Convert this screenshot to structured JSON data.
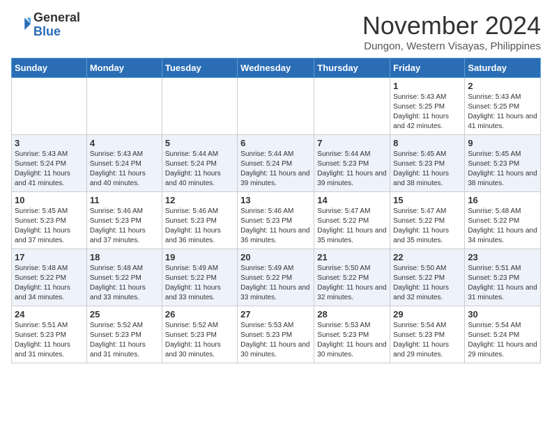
{
  "logo": {
    "general": "General",
    "blue": "Blue"
  },
  "header": {
    "month_title": "November 2024",
    "subtitle": "Dungon, Western Visayas, Philippines"
  },
  "weekdays": [
    "Sunday",
    "Monday",
    "Tuesday",
    "Wednesday",
    "Thursday",
    "Friday",
    "Saturday"
  ],
  "weeks": [
    [
      {
        "day": "",
        "info": ""
      },
      {
        "day": "",
        "info": ""
      },
      {
        "day": "",
        "info": ""
      },
      {
        "day": "",
        "info": ""
      },
      {
        "day": "",
        "info": ""
      },
      {
        "day": "1",
        "info": "Sunrise: 5:43 AM\nSunset: 5:25 PM\nDaylight: 11 hours and 42 minutes."
      },
      {
        "day": "2",
        "info": "Sunrise: 5:43 AM\nSunset: 5:25 PM\nDaylight: 11 hours and 41 minutes."
      }
    ],
    [
      {
        "day": "3",
        "info": "Sunrise: 5:43 AM\nSunset: 5:24 PM\nDaylight: 11 hours and 41 minutes."
      },
      {
        "day": "4",
        "info": "Sunrise: 5:43 AM\nSunset: 5:24 PM\nDaylight: 11 hours and 40 minutes."
      },
      {
        "day": "5",
        "info": "Sunrise: 5:44 AM\nSunset: 5:24 PM\nDaylight: 11 hours and 40 minutes."
      },
      {
        "day": "6",
        "info": "Sunrise: 5:44 AM\nSunset: 5:24 PM\nDaylight: 11 hours and 39 minutes."
      },
      {
        "day": "7",
        "info": "Sunrise: 5:44 AM\nSunset: 5:23 PM\nDaylight: 11 hours and 39 minutes."
      },
      {
        "day": "8",
        "info": "Sunrise: 5:45 AM\nSunset: 5:23 PM\nDaylight: 11 hours and 38 minutes."
      },
      {
        "day": "9",
        "info": "Sunrise: 5:45 AM\nSunset: 5:23 PM\nDaylight: 11 hours and 38 minutes."
      }
    ],
    [
      {
        "day": "10",
        "info": "Sunrise: 5:45 AM\nSunset: 5:23 PM\nDaylight: 11 hours and 37 minutes."
      },
      {
        "day": "11",
        "info": "Sunrise: 5:46 AM\nSunset: 5:23 PM\nDaylight: 11 hours and 37 minutes."
      },
      {
        "day": "12",
        "info": "Sunrise: 5:46 AM\nSunset: 5:23 PM\nDaylight: 11 hours and 36 minutes."
      },
      {
        "day": "13",
        "info": "Sunrise: 5:46 AM\nSunset: 5:23 PM\nDaylight: 11 hours and 36 minutes."
      },
      {
        "day": "14",
        "info": "Sunrise: 5:47 AM\nSunset: 5:22 PM\nDaylight: 11 hours and 35 minutes."
      },
      {
        "day": "15",
        "info": "Sunrise: 5:47 AM\nSunset: 5:22 PM\nDaylight: 11 hours and 35 minutes."
      },
      {
        "day": "16",
        "info": "Sunrise: 5:48 AM\nSunset: 5:22 PM\nDaylight: 11 hours and 34 minutes."
      }
    ],
    [
      {
        "day": "17",
        "info": "Sunrise: 5:48 AM\nSunset: 5:22 PM\nDaylight: 11 hours and 34 minutes."
      },
      {
        "day": "18",
        "info": "Sunrise: 5:48 AM\nSunset: 5:22 PM\nDaylight: 11 hours and 33 minutes."
      },
      {
        "day": "19",
        "info": "Sunrise: 5:49 AM\nSunset: 5:22 PM\nDaylight: 11 hours and 33 minutes."
      },
      {
        "day": "20",
        "info": "Sunrise: 5:49 AM\nSunset: 5:22 PM\nDaylight: 11 hours and 33 minutes."
      },
      {
        "day": "21",
        "info": "Sunrise: 5:50 AM\nSunset: 5:22 PM\nDaylight: 11 hours and 32 minutes."
      },
      {
        "day": "22",
        "info": "Sunrise: 5:50 AM\nSunset: 5:22 PM\nDaylight: 11 hours and 32 minutes."
      },
      {
        "day": "23",
        "info": "Sunrise: 5:51 AM\nSunset: 5:23 PM\nDaylight: 11 hours and 31 minutes."
      }
    ],
    [
      {
        "day": "24",
        "info": "Sunrise: 5:51 AM\nSunset: 5:23 PM\nDaylight: 11 hours and 31 minutes."
      },
      {
        "day": "25",
        "info": "Sunrise: 5:52 AM\nSunset: 5:23 PM\nDaylight: 11 hours and 31 minutes."
      },
      {
        "day": "26",
        "info": "Sunrise: 5:52 AM\nSunset: 5:23 PM\nDaylight: 11 hours and 30 minutes."
      },
      {
        "day": "27",
        "info": "Sunrise: 5:53 AM\nSunset: 5:23 PM\nDaylight: 11 hours and 30 minutes."
      },
      {
        "day": "28",
        "info": "Sunrise: 5:53 AM\nSunset: 5:23 PM\nDaylight: 11 hours and 30 minutes."
      },
      {
        "day": "29",
        "info": "Sunrise: 5:54 AM\nSunset: 5:23 PM\nDaylight: 11 hours and 29 minutes."
      },
      {
        "day": "30",
        "info": "Sunrise: 5:54 AM\nSunset: 5:24 PM\nDaylight: 11 hours and 29 minutes."
      }
    ]
  ]
}
